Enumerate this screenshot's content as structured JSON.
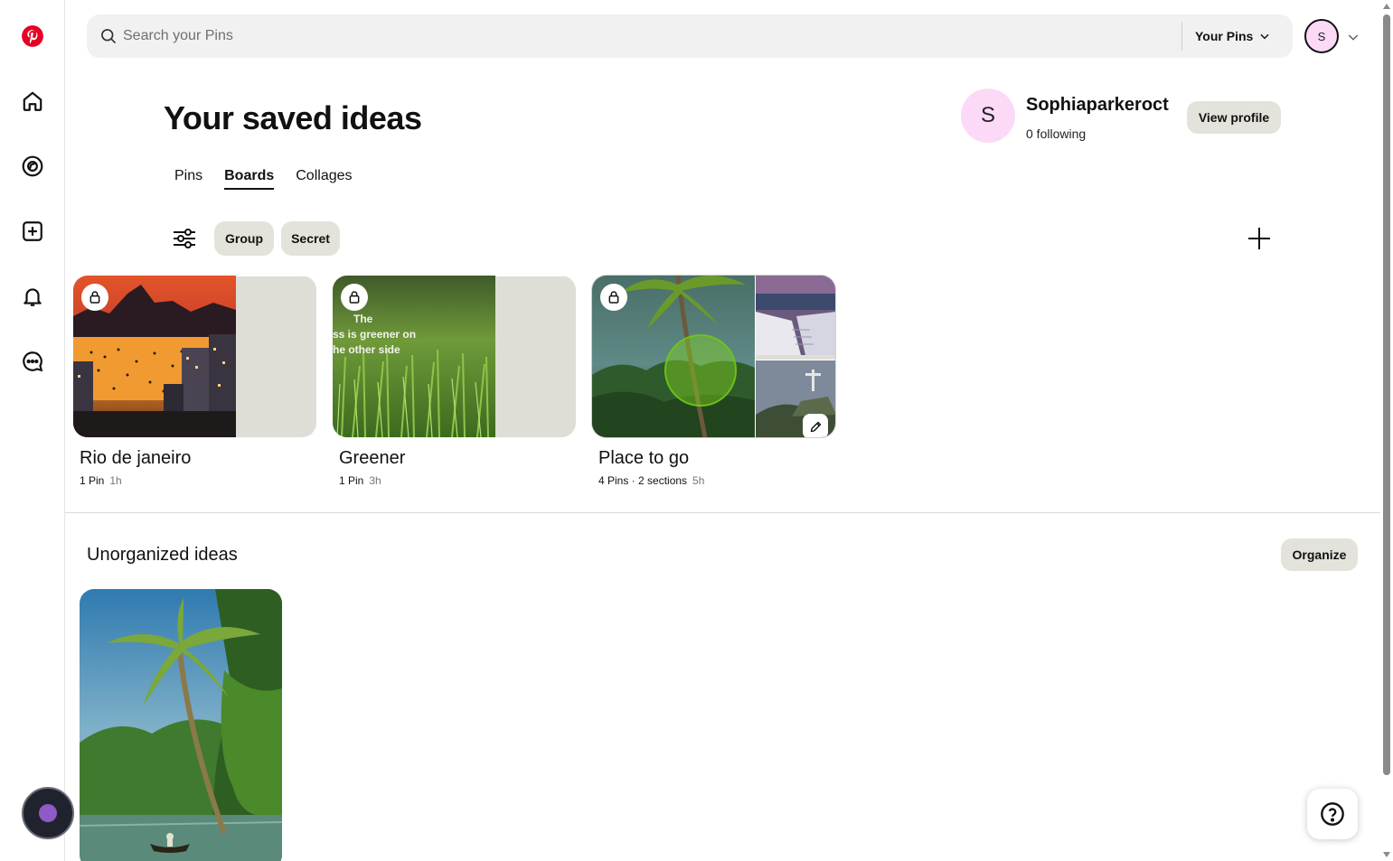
{
  "app": {
    "brand_color": "#e60023",
    "accent_chip_color": "#e3e3db"
  },
  "rail": {
    "items": [
      {
        "icon": "pinterest-logo-icon"
      },
      {
        "icon": "home-icon"
      },
      {
        "icon": "explore-icon"
      },
      {
        "icon": "create-icon"
      },
      {
        "icon": "notifications-icon"
      },
      {
        "icon": "messages-icon"
      }
    ]
  },
  "search": {
    "placeholder": "Search your Pins",
    "scope_label": "Your Pins"
  },
  "account": {
    "initial": "S"
  },
  "header": {
    "title": "Your saved ideas",
    "profile_initial": "S",
    "profile_name": "Sophiaparkeroct",
    "following": "0 following",
    "view_profile_label": "View profile"
  },
  "tabs": [
    {
      "label": "Pins",
      "active": false
    },
    {
      "label": "Boards",
      "active": true
    },
    {
      "label": "Collages",
      "active": false
    }
  ],
  "filters": {
    "chips": [
      "Group",
      "Secret"
    ]
  },
  "boards": [
    {
      "name": "Rio de janeiro",
      "pins": "1 Pin",
      "age": "1h",
      "secret": true
    },
    {
      "name": "Greener",
      "pins": "1 Pin",
      "age": "3h",
      "secret": true,
      "cover_text": [
        "The",
        "ss is greener on",
        "he other side"
      ]
    },
    {
      "name": "Place to go",
      "pins": "4 Pins · 2 sections",
      "age": "5h",
      "secret": true
    }
  ],
  "unorganized": {
    "title": "Unorganized ideas",
    "organize_label": "Organize"
  }
}
